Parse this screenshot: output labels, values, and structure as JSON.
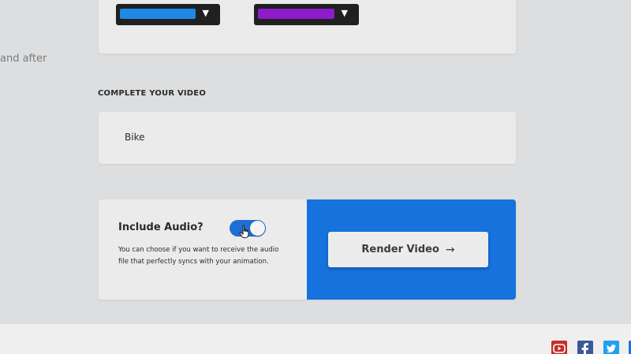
{
  "sidebar": {
    "partial_text": "and after"
  },
  "color_pickers": [
    {
      "swatch_color": "#1e88e5",
      "arrow": "▼"
    },
    {
      "swatch_color": "#8e1bcc",
      "arrow": "▼"
    }
  ],
  "complete_section": {
    "title": "COMPLETE YOUR VIDEO",
    "name_value": "Bike"
  },
  "audio": {
    "label": "Include Audio?",
    "enabled": true,
    "description": "You can choose if you want to receive the audio file that perfectly syncs with your animation."
  },
  "render": {
    "button_label": "Render Video",
    "arrow": "→"
  },
  "footer": {
    "social_icons": [
      "youtube-icon",
      "facebook-icon",
      "twitter-icon",
      "linkedin-icon"
    ]
  },
  "colors": {
    "accent": "#1672dc",
    "toggle_on": "#1f6ed4",
    "background": "#dddee0",
    "card": "#ebebeb"
  }
}
